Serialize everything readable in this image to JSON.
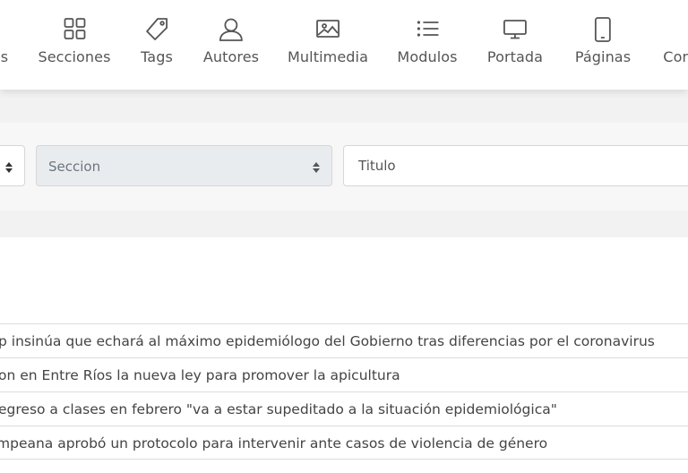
{
  "nav": [
    {
      "label": "as",
      "icon": "list-icon"
    },
    {
      "label": "Secciones",
      "icon": "grid-icon"
    },
    {
      "label": "Tags",
      "icon": "tag-icon"
    },
    {
      "label": "Autores",
      "icon": "user-icon"
    },
    {
      "label": "Multimedia",
      "icon": "image-icon"
    },
    {
      "label": "Modulos",
      "icon": "list-icon"
    },
    {
      "label": "Portada",
      "icon": "desktop-icon"
    },
    {
      "label": "Páginas",
      "icon": "mobile-icon"
    },
    {
      "label": "Con",
      "icon": "unknown-icon"
    }
  ],
  "filters": {
    "section_placeholder": "Seccion",
    "title_placeholder": "Titulo"
  },
  "articles": [
    "p insinúa que echará al máximo epidemiólogo del Gobierno tras diferencias por el coronavirus",
    "on en Entre Ríos la nueva ley para promover la apicultura",
    "egreso a clases en febrero \"va a estar supeditado a la situación epidemiológica\"",
    "mpeana aprobó un protocolo para intervenir ante casos de violencia de género"
  ]
}
